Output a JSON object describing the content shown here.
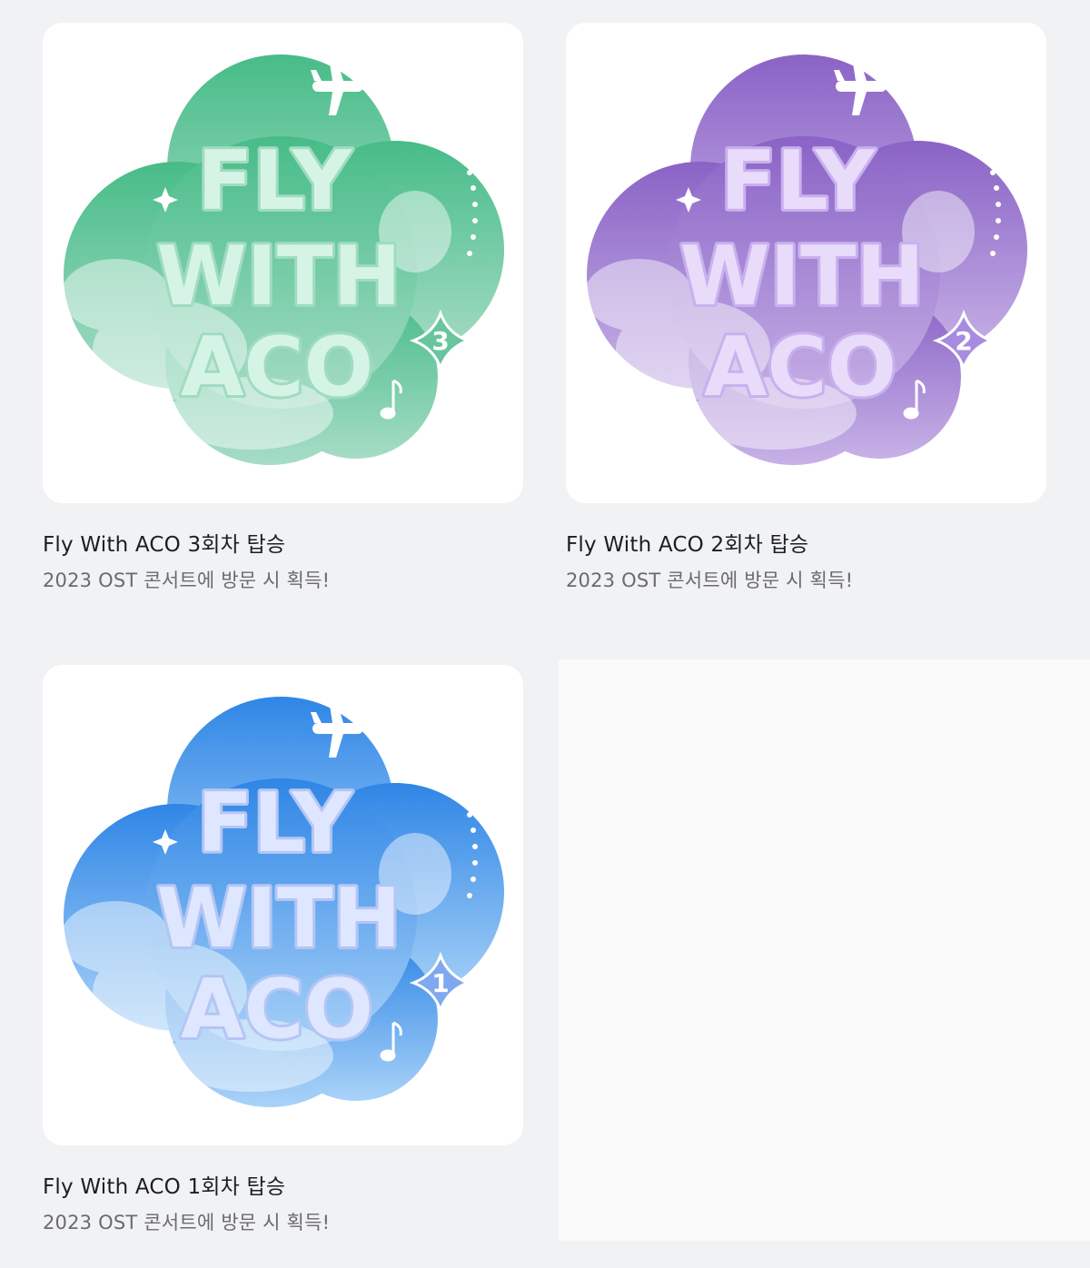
{
  "badges": [
    {
      "title": "Fly With ACO 3회차 탑승",
      "description": "2023 OST 콘서트에 방문 시 획득!",
      "logo": {
        "line1": "FLY",
        "line2": "WITH",
        "line3": "ACO",
        "number": "3"
      },
      "theme": {
        "top": "#47bc88",
        "bottom": "#a6dcc6",
        "letter": "#d6f4e6",
        "stroke": "#9fdcc0",
        "star": "#68c59e"
      },
      "icon": "airplane-icon"
    },
    {
      "title": "Fly With ACO 2회차 탑승",
      "description": "2023 OST 콘서트에 방문 시 획득!",
      "logo": {
        "line1": "FLY",
        "line2": "WITH",
        "line3": "ACO",
        "number": "2"
      },
      "theme": {
        "top": "#8a63c6",
        "bottom": "#c7b1e6",
        "letter": "#e8dcfa",
        "stroke": "#c9b0ee",
        "star": "#a78be0"
      },
      "icon": "airplane-icon"
    },
    {
      "title": "Fly With ACO 1회차 탑승",
      "description": "2023 OST 콘서트에 방문 시 획득!",
      "logo": {
        "line1": "FLY",
        "line2": "WITH",
        "line3": "ACO",
        "number": "1"
      },
      "theme": {
        "top": "#2f86e6",
        "bottom": "#a9d2f8",
        "letter": "#dfe6ff",
        "stroke": "#b3c6f4",
        "star": "#7fa8ef"
      },
      "icon": "airplane-icon"
    }
  ],
  "colors": {
    "page_background": "#f1f2f4",
    "card_background": "#ffffff",
    "title_text": "#1d1d1f",
    "description_text": "#6b6b6f"
  }
}
